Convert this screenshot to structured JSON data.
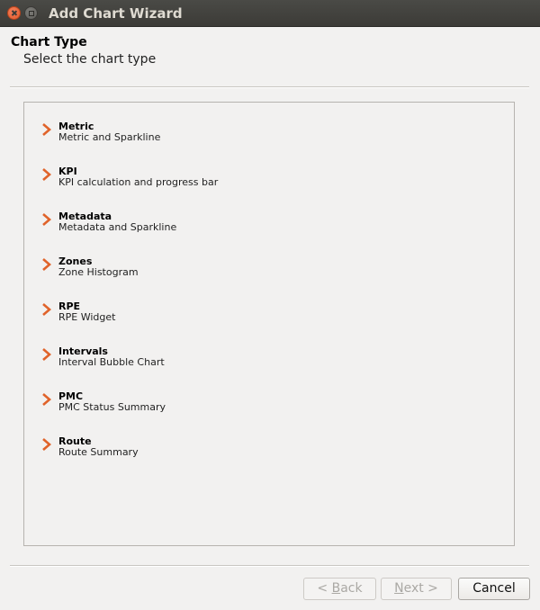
{
  "window": {
    "title": "Add Chart Wizard"
  },
  "heading": {
    "title": "Chart Type",
    "subtitle": "Select the chart type"
  },
  "chart_types": [
    {
      "name": "Metric",
      "description": "Metric and Sparkline"
    },
    {
      "name": "KPI",
      "description": "KPI calculation and progress bar"
    },
    {
      "name": "Metadata",
      "description": "Metadata and Sparkline"
    },
    {
      "name": "Zones",
      "description": "Zone Histogram"
    },
    {
      "name": "RPE",
      "description": "RPE Widget"
    },
    {
      "name": "Intervals",
      "description": "Interval Bubble Chart"
    },
    {
      "name": "PMC",
      "description": "PMC Status Summary"
    },
    {
      "name": "Route",
      "description": "Route Summary"
    }
  ],
  "buttons": {
    "back": {
      "prefix": "< ",
      "mnemonic": "B",
      "rest": "ack",
      "enabled": false
    },
    "next": {
      "mnemonic": "N",
      "rest": "ext >",
      "enabled": false
    },
    "cancel": {
      "label": "Cancel",
      "enabled": true
    }
  },
  "colors": {
    "chevron": "#e0632a",
    "titlebar": "#3c3b37",
    "close_button": "#e95f2c"
  },
  "icons": {
    "item_marker": "chevron-right-icon"
  }
}
